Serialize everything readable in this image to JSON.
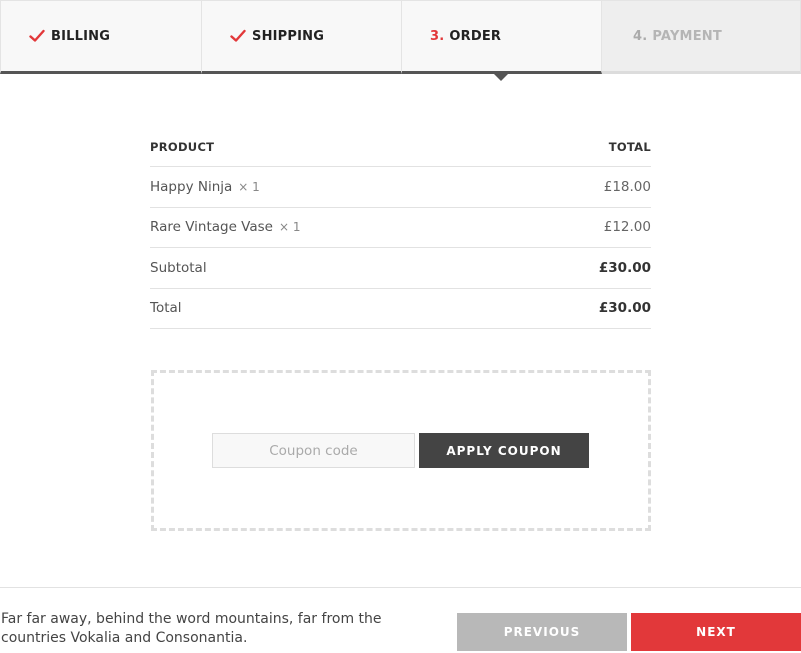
{
  "steps": [
    {
      "label": "BILLING",
      "state": "done"
    },
    {
      "label": "SHIPPING",
      "state": "done"
    },
    {
      "number": "3.",
      "label": "ORDER",
      "state": "active"
    },
    {
      "number": "4.",
      "label": "PAYMENT",
      "state": "upcoming"
    }
  ],
  "order": {
    "headers": {
      "product": "PRODUCT",
      "total": "TOTAL"
    },
    "items": [
      {
        "name": "Happy Ninja",
        "qty": "× 1",
        "price": "£18.00"
      },
      {
        "name": "Rare Vintage Vase",
        "qty": "× 1",
        "price": "£12.00"
      }
    ],
    "subtotal": {
      "label": "Subtotal",
      "value": "£30.00"
    },
    "total": {
      "label": "Total",
      "value": "£30.00"
    }
  },
  "coupon": {
    "placeholder": "Coupon code",
    "value": "",
    "apply_label": "APPLY COUPON"
  },
  "footer": {
    "text": "Far far away, behind the word mountains, far from the countries Vokalia and Consonantia.",
    "previous_label": "PREVIOUS",
    "next_label": "NEXT"
  },
  "colors": {
    "accent": "#e2383a",
    "dark": "#444444",
    "disabled": "#b8b8b8"
  },
  "icons": {
    "done": "checkmark-icon"
  }
}
